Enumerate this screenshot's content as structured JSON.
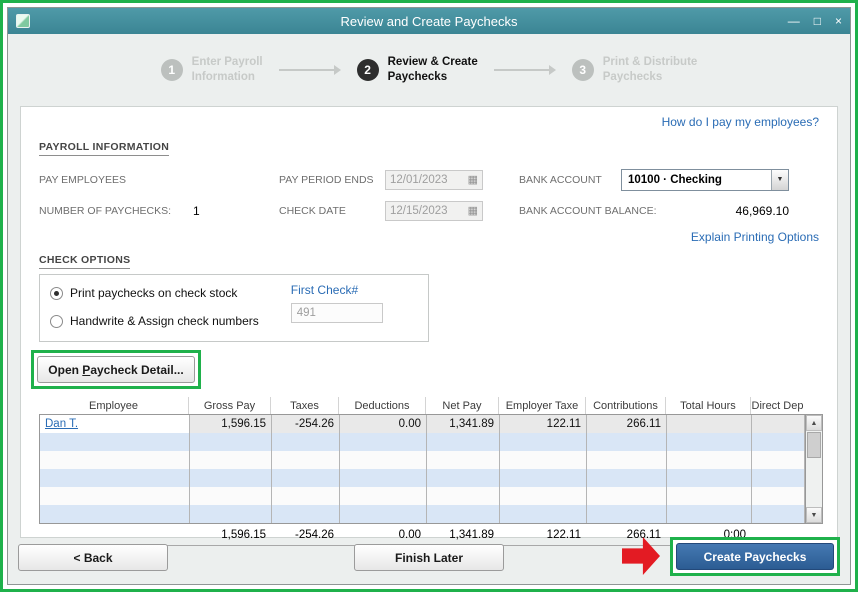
{
  "window": {
    "title": "Review and Create Paychecks"
  },
  "steps": {
    "items": [
      {
        "num": "1",
        "line1": "Enter Payroll",
        "line2": "Information",
        "active": false
      },
      {
        "num": "2",
        "line1": "Review & Create",
        "line2": "Paychecks",
        "active": true
      },
      {
        "num": "3",
        "line1": "Print & Distribute",
        "line2": "Paychecks",
        "active": false
      }
    ]
  },
  "links": {
    "help": "How do I pay my employees?",
    "explain_printing": "Explain Printing Options"
  },
  "payroll_information": {
    "section_title": "PAYROLL INFORMATION",
    "pay_employees_label": "PAY EMPLOYEES",
    "number_of_paychecks_label": "NUMBER OF PAYCHECKS:",
    "number_of_paychecks_value": "1",
    "pay_period_ends_label": "PAY PERIOD ENDS",
    "pay_period_ends_value": "12/01/2023",
    "check_date_label": "CHECK DATE",
    "check_date_value": "12/15/2023",
    "bank_account_label": "BANK ACCOUNT",
    "bank_account_value": "10100 · Checking",
    "bank_balance_label": "BANK ACCOUNT BALANCE:",
    "bank_balance_value": "46,969.10"
  },
  "check_options": {
    "section_title": "CHECK OPTIONS",
    "option_print": "Print paychecks on check stock",
    "option_handwrite": "Handwrite & Assign check numbers",
    "first_check_label": "First Check#",
    "first_check_value": "491"
  },
  "open_paycheck_detail": {
    "pre": "Open ",
    "mnemonic": "P",
    "post": "aycheck Detail..."
  },
  "table": {
    "columns": [
      "Employee",
      "Gross Pay",
      "Taxes",
      "Deductions",
      "Net Pay",
      "Employer Taxe",
      "Contributions",
      "Total Hours",
      "Direct Dep"
    ],
    "rows": [
      {
        "employee": "Dan T.",
        "gross_pay": "1,596.15",
        "taxes": "-254.26",
        "deductions": "0.00",
        "net_pay": "1,341.89",
        "employer_taxes": "122.11",
        "contributions": "266.11",
        "total_hours": "",
        "direct_dep": ""
      }
    ],
    "totals": {
      "gross_pay": "1,596.15",
      "taxes": "-254.26",
      "deductions": "0.00",
      "net_pay": "1,341.89",
      "employer_taxes": "122.11",
      "contributions": "266.11",
      "total_hours": "0:00",
      "direct_dep": ""
    }
  },
  "footer": {
    "back": "< Back",
    "finish_later": "Finish Later",
    "create": "Create Paychecks"
  },
  "icons": {
    "calendar": "▦",
    "dropdown_arrow": "▼",
    "scroll_up": "▲",
    "scroll_down": "▼",
    "minimize": "—",
    "maximize": "□",
    "close": "×"
  },
  "colors": {
    "titlebar_teal": "#43909e",
    "annotation_green": "#1fb14b",
    "arrow_red": "#e31b23",
    "link_blue": "#2a6cb5",
    "create_button_blue": "#2d5c93"
  }
}
